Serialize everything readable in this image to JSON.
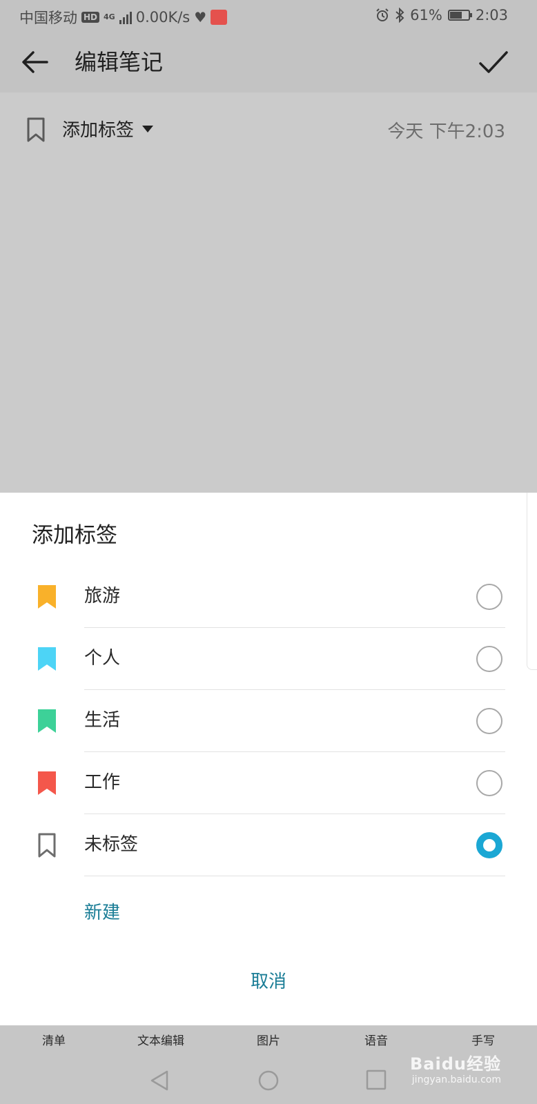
{
  "status_bar": {
    "carrier": "中国移动",
    "hd_badge": "HD",
    "network": "4G",
    "speed": "0.00K/s",
    "battery_percent": "61%",
    "time": "2:03",
    "icons": [
      "hd-icon",
      "signal-icon",
      "heart-rate-icon",
      "app-notification-icon",
      "alarm-icon",
      "bluetooth-icon",
      "battery-icon"
    ]
  },
  "app_bar": {
    "title": "编辑笔记",
    "back_icon": "arrow-left-icon",
    "confirm_icon": "check-icon"
  },
  "note": {
    "tag_selector_label": "添加标签",
    "timestamp": "今天 下午2:03"
  },
  "dialog": {
    "title": "添加标签",
    "options": [
      {
        "label": "旅游",
        "color": "#f9b12a",
        "selected": false
      },
      {
        "label": "个人",
        "color": "#4dd4f6",
        "selected": false
      },
      {
        "label": "生活",
        "color": "#3dd198",
        "selected": false
      },
      {
        "label": "工作",
        "color": "#f4574b",
        "selected": false
      },
      {
        "label": "未标签",
        "color": "#6d6d6d",
        "selected": true
      }
    ],
    "new_label": "新建",
    "cancel_label": "取消",
    "accent_color": "#1ba7d4"
  },
  "toolbar": {
    "items": [
      "清单",
      "文本编辑",
      "图片",
      "语音",
      "手写"
    ]
  },
  "nav_bar": {
    "icons": [
      "nav-back-icon",
      "nav-home-icon",
      "nav-recent-icon"
    ]
  },
  "watermark": {
    "main": "Baidu经验",
    "sub": "jingyan.baidu.com"
  }
}
